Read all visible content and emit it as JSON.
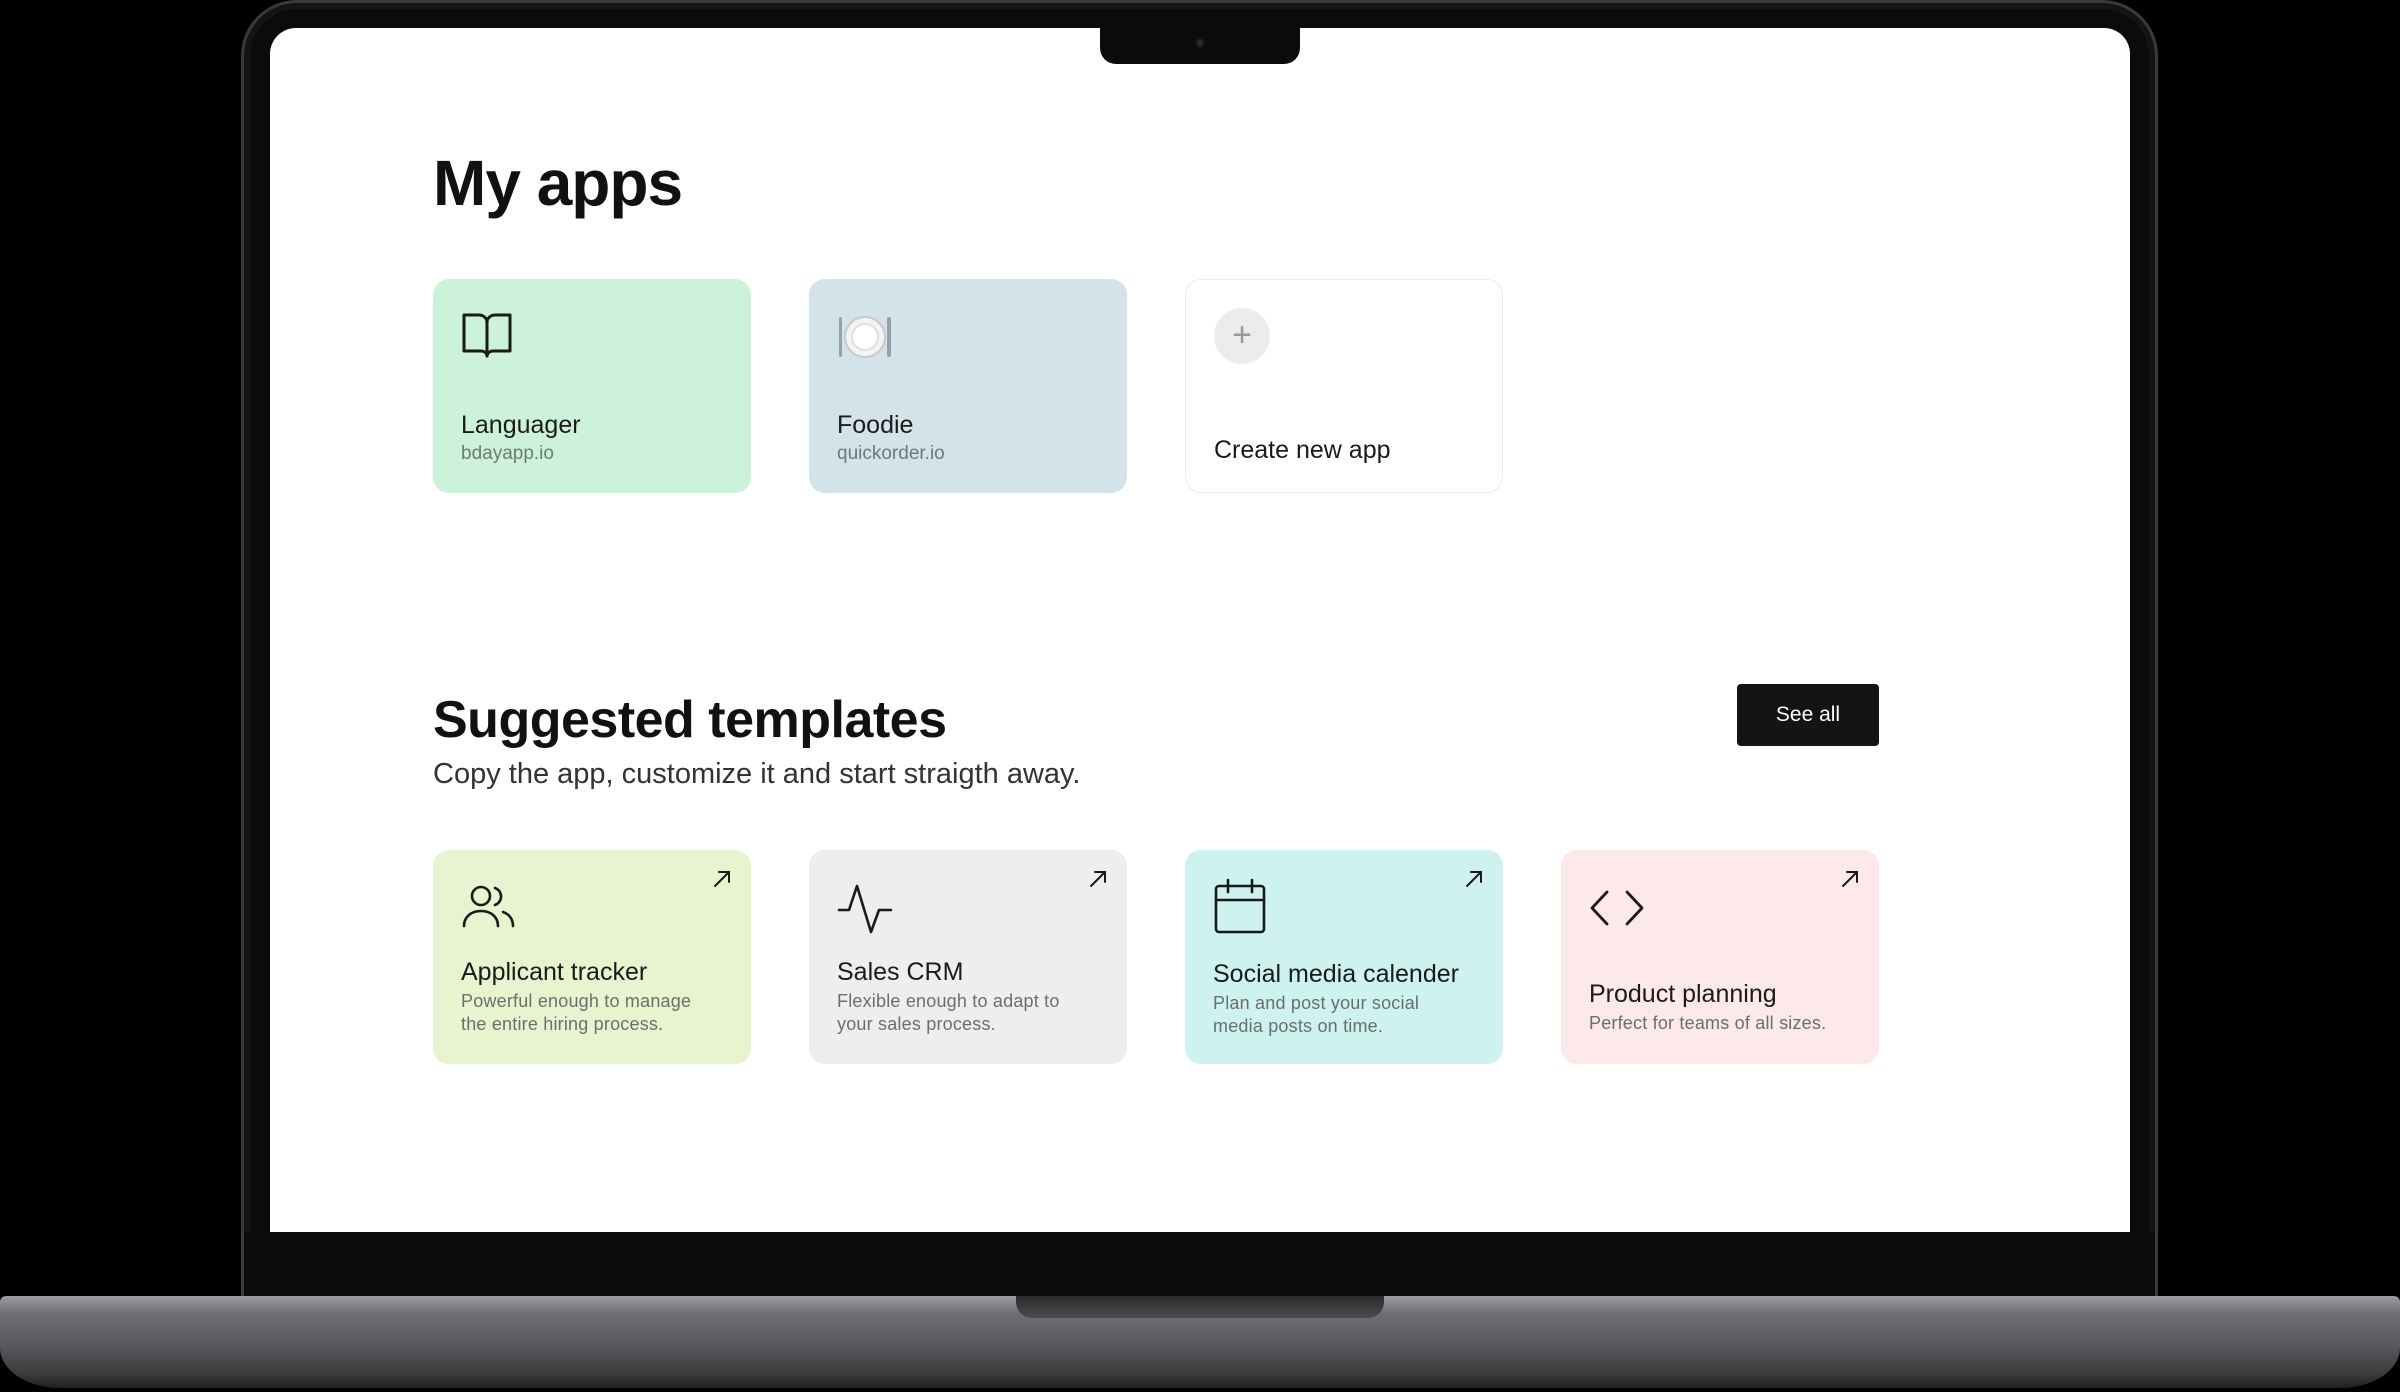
{
  "my_apps": {
    "title": "My apps",
    "apps": [
      {
        "name": "Languager",
        "url": "bdayapp.io",
        "icon": "book-icon",
        "color": "#ccf3da"
      },
      {
        "name": "Foodie",
        "url": "quickorder.io",
        "icon": "plate-icon",
        "color": "#d3e3ea"
      }
    ],
    "create_label": "Create new app",
    "create_icon": "plus-icon"
  },
  "templates": {
    "title": "Suggested templates",
    "subtitle": "Copy the app, customize it and start straigth away.",
    "see_all_label": "See all",
    "items": [
      {
        "name": "Applicant tracker",
        "desc_line1": "Powerful enough to manage",
        "desc_line2": "the entire hiring process.",
        "icon": "users-icon",
        "color": "#e8f3d0"
      },
      {
        "name": "Sales CRM",
        "desc_line1": "Flexible enough to adapt to",
        "desc_line2": "your sales process.",
        "icon": "activity-icon",
        "color": "#eeeeee"
      },
      {
        "name": "Social media calender",
        "desc_line1": "Plan and post your social",
        "desc_line2": "media posts on time.",
        "icon": "calendar-icon",
        "color": "#cdf2ef"
      },
      {
        "name": "Product planning",
        "desc_line1": "Perfect for teams of all sizes.",
        "desc_line2": "",
        "icon": "code-icon",
        "color": "#fde9e9"
      }
    ]
  }
}
